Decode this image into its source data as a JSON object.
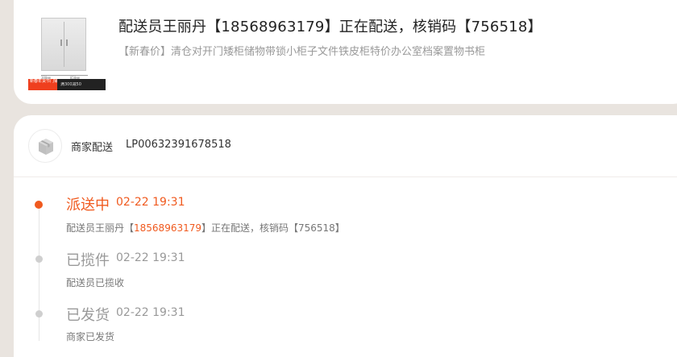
{
  "order": {
    "title": "配送员王丽丹【18568963179】正在配送，核销码【756518】",
    "product_name": "【新春价】清仓对开门矮柜储物带锁小柜子文件铁皮柜特价办公室档案置物书柜",
    "image": {
      "promo_badge": "新春年货节门铺",
      "promo_text": "满300减50",
      "dim_left": "380mm",
      "dim_right": "850mm"
    }
  },
  "courier": {
    "label": "商家配送",
    "tracking_number": "LP00632391678518",
    "icon": "package-box-icon"
  },
  "events": [
    {
      "status": "派送中",
      "time": "02-22 19:31",
      "desc_prefix": "配送员王丽丹【",
      "desc_phone": "18568963179",
      "desc_suffix": "】正在配送，核销码【756518】",
      "active": true
    },
    {
      "status": "已揽件",
      "time": "02-22 19:31",
      "desc": "配送员已揽收",
      "active": false
    },
    {
      "status": "已发货",
      "time": "02-22 19:31",
      "desc": "商家已发货",
      "active": false
    }
  ],
  "colors": {
    "accent": "#f05a1f",
    "page_bg": "#e9e4df",
    "muted_text": "#999999"
  }
}
